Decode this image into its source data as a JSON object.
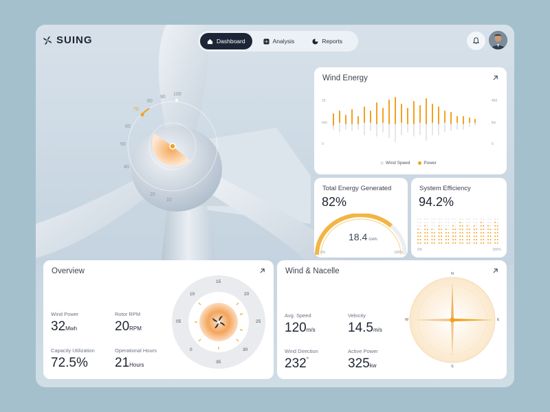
{
  "brand": {
    "name": "SUING"
  },
  "nav": {
    "dashboard": "Dashboard",
    "analysis": "Analysis",
    "reports": "Reports"
  },
  "hero_dial": {
    "ticks": [
      "10",
      "20",
      "40",
      "50",
      "60",
      "70",
      "80",
      "90",
      "100"
    ]
  },
  "wind_energy": {
    "title": "Wind Energy",
    "left_top": "15",
    "left_mid": "m/s",
    "left_bottom": "0",
    "right_top": "450",
    "right_mid": "kw",
    "right_bottom": "0",
    "legend_wind": "Wind Speed",
    "legend_power": "Power"
  },
  "total_energy": {
    "title": "Total Energy Generated",
    "percent": "82%",
    "value": "18.4",
    "unit": "GWh",
    "min": "0%",
    "max": "100%"
  },
  "efficiency": {
    "title": "System Efficiency",
    "percent": "94.2%",
    "min": "0%",
    "max": "100%"
  },
  "overview": {
    "title": "Overview",
    "wind_power_label": "Wind Power",
    "wind_power_value": "32",
    "wind_power_unit": "Mwh",
    "rotor_label": "Rotor RPM",
    "rotor_value": "20",
    "rotor_unit": "RPM",
    "capacity_label": "Capacity Utilization",
    "capacity_value": "72.5%",
    "hours_label": "Operational Hours",
    "hours_value": "21",
    "hours_unit": "Hours",
    "dial": [
      "15",
      "20",
      "25",
      "30",
      "35",
      "0",
      "05",
      "10"
    ]
  },
  "nacelle": {
    "title": "Wind & Nacelle",
    "avg_speed_label": "Avg. Speed",
    "avg_speed_value": "120",
    "avg_speed_unit": "m/s",
    "velocity_label": "Velocity",
    "velocity_value": "14.5",
    "velocity_unit": "m/s",
    "direction_label": "Wind Direction",
    "direction_value": "232",
    "direction_unit": "°",
    "power_label": "Active Power",
    "power_value": "325",
    "power_unit": "kw",
    "compass": {
      "n": "N",
      "e": "E",
      "s": "S",
      "w": "W"
    }
  },
  "colors": {
    "accent": "#f2a11f",
    "dark": "#1d2636",
    "muted": "#e1e4e8"
  }
}
